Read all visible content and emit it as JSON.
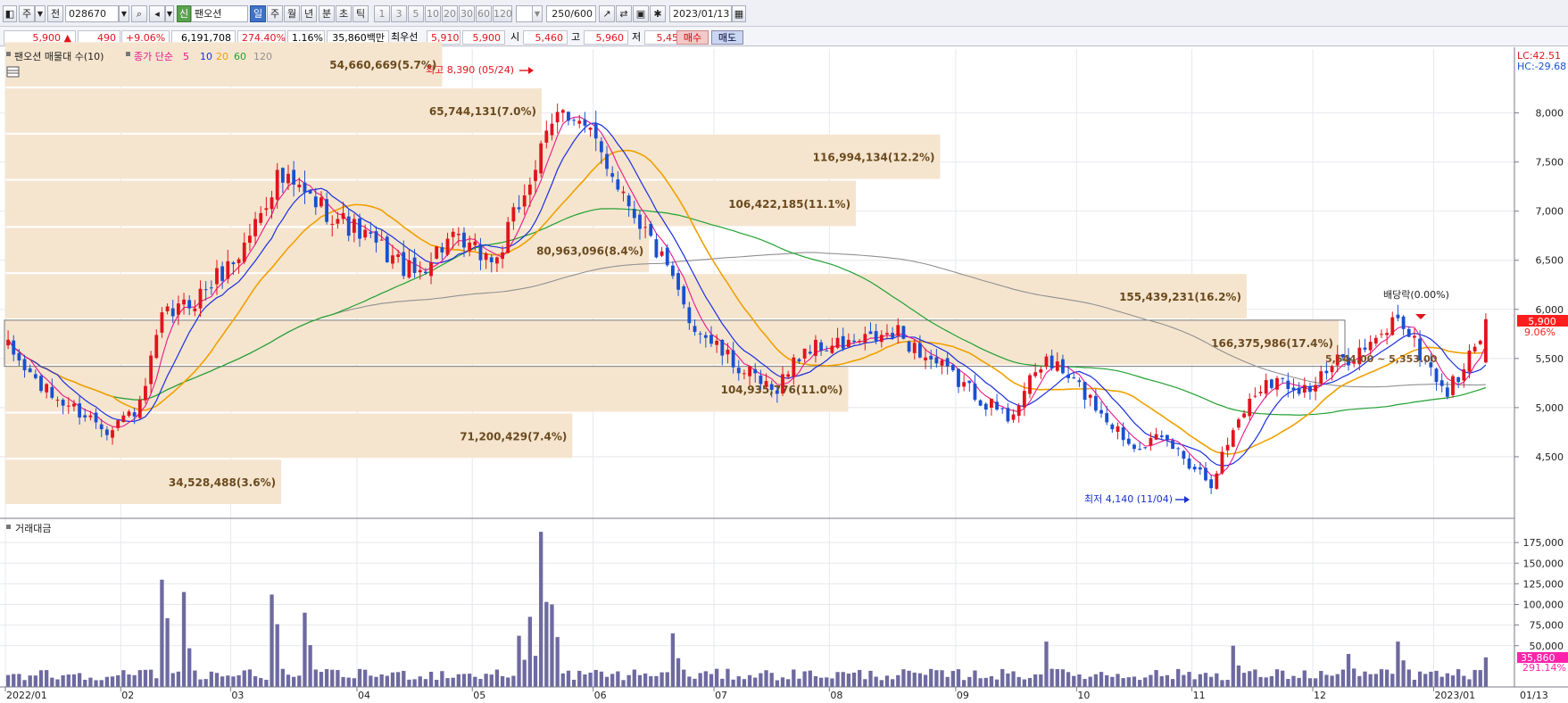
{
  "toolbar": {
    "type_btn": "주",
    "prev_btn": "전",
    "stock_code": "028670",
    "badge": "신",
    "stock_name": "팬오션",
    "periods": [
      "일",
      "주",
      "월",
      "년",
      "분",
      "초",
      "틱"
    ],
    "intervals": [
      "1",
      "3",
      "5",
      "10",
      "20",
      "30",
      "60",
      "120"
    ],
    "count": "250/600",
    "date": "2023/01/13"
  },
  "quote": {
    "price": "5,900",
    "up_arrow": "▲",
    "change": "490",
    "change_pct": "+9.06%",
    "volume": "6,191,708",
    "vol_ratio": "274.40%",
    "turnover": "1.16%",
    "amount": "35,860백만",
    "best_ask_label": "최우선",
    "best_ask_1": "5,910",
    "best_ask_2": "5,900",
    "open_label": "시",
    "open": "5,460",
    "high_label": "고",
    "high": "5,960",
    "low_label": "저",
    "low": "5,450",
    "buy_btn": "매수",
    "sell_btn": "매도"
  },
  "legend": {
    "main": "팬오션 매물대 수(10)",
    "ma_prefix": "종가 단순",
    "ma_periods": [
      "5",
      "10",
      "20",
      "60",
      "120"
    ],
    "volume_panel": "거래대금"
  },
  "colors": {
    "up": "#e0141e",
    "down": "#1a50d0",
    "ma5": "#e8188c",
    "ma10": "#1a2ee0",
    "ma20": "#f0a000",
    "ma60": "#20a030",
    "ma120": "#909090",
    "volume_bar": "#6e6aa0",
    "volume_profile": "#f5e5cf"
  },
  "price_panel": {
    "lc": "LC:42.51",
    "hc": "HC:-29.68",
    "current_price": "5,900",
    "current_pct": "9.06%",
    "high_marker": "최고 8,390 (05/24)",
    "low_marker": "최저 4,140 (11/04)",
    "dividend": "배당락(0.00%)",
    "range_note": "5,544.00 ~ 5,353.00"
  },
  "volume_panel": {
    "current_value": "35,860",
    "current_pct": "291.14%"
  },
  "chart_data": [
    {
      "type": "candlestick",
      "title": "팬오션 매물대 수(10)",
      "x_tick_labels": [
        "2022/01",
        "02",
        "03",
        "04",
        "05",
        "06",
        "07",
        "08",
        "09",
        "10",
        "11",
        "12",
        "2023/01",
        "01/13"
      ],
      "y_ticks": [
        4500,
        5000,
        5500,
        6000,
        6500,
        7000,
        7500,
        8000
      ],
      "y_tick_labels": [
        "4,500",
        "5,000",
        "5,500",
        "6,000",
        "6,500",
        "7,000",
        "7,500",
        "8,000"
      ],
      "ylim": [
        3900,
        8650
      ],
      "price_path": [
        {
          "x": "2022/01/03",
          "y": 5600
        },
        {
          "x": "2022/01/12",
          "y": 5150
        },
        {
          "x": "2022/01/27",
          "y": 4800
        },
        {
          "x": "2022/02/04",
          "y": 5000
        },
        {
          "x": "2022/02/10",
          "y": 5900
        },
        {
          "x": "2022/02/18",
          "y": 6100
        },
        {
          "x": "2022/03/02",
          "y": 6550
        },
        {
          "x": "2022/03/11",
          "y": 7350
        },
        {
          "x": "2022/03/23",
          "y": 7050
        },
        {
          "x": "2022/04/05",
          "y": 6700
        },
        {
          "x": "2022/04/15",
          "y": 6350
        },
        {
          "x": "2022/04/25",
          "y": 6700
        },
        {
          "x": "2022/05/06",
          "y": 6500
        },
        {
          "x": "2022/05/13",
          "y": 7200
        },
        {
          "x": "2022/05/24",
          "y": 8100
        },
        {
          "x": "2022/06/02",
          "y": 7600
        },
        {
          "x": "2022/06/10",
          "y": 7000
        },
        {
          "x": "2022/06/17",
          "y": 6500
        },
        {
          "x": "2022/06/24",
          "y": 5900
        },
        {
          "x": "2022/07/05",
          "y": 5500
        },
        {
          "x": "2022/07/15",
          "y": 5150
        },
        {
          "x": "2022/07/25",
          "y": 5600
        },
        {
          "x": "2022/08/05",
          "y": 5650
        },
        {
          "x": "2022/08/17",
          "y": 5750
        },
        {
          "x": "2022/08/30",
          "y": 5350
        },
        {
          "x": "2022/09/14",
          "y": 4900
        },
        {
          "x": "2022/09/23",
          "y": 5500
        },
        {
          "x": "2022/10/04",
          "y": 5150
        },
        {
          "x": "2022/10/14",
          "y": 4650
        },
        {
          "x": "2022/10/25",
          "y": 4650
        },
        {
          "x": "2022/11/04",
          "y": 4250
        },
        {
          "x": "2022/11/11",
          "y": 4900
        },
        {
          "x": "2022/11/18",
          "y": 5300
        },
        {
          "x": "2022/11/30",
          "y": 5200
        },
        {
          "x": "2022/12/08",
          "y": 5500
        },
        {
          "x": "2022/12/16",
          "y": 5650
        },
        {
          "x": "2022/12/22",
          "y": 5950
        },
        {
          "x": "2022/12/28",
          "y": 5550
        },
        {
          "x": "2023/01/04",
          "y": 5150
        },
        {
          "x": "2023/01/10",
          "y": 5500
        },
        {
          "x": "2023/01/13",
          "y": 5900
        }
      ],
      "volume_profile": [
        {
          "label": "34,528,488(3.6%)",
          "from": 4000,
          "to": 4470,
          "pct": 3.6
        },
        {
          "label": "71,200,429(7.4%)",
          "from": 4470,
          "to": 4940,
          "pct": 7.4
        },
        {
          "label": "104,935,776(11.0%)",
          "from": 4940,
          "to": 5420,
          "pct": 11.0
        },
        {
          "label": "166,375,986(17.4%)",
          "from": 5420,
          "to": 5890,
          "pct": 17.4
        },
        {
          "label": "155,439,231(16.2%)",
          "from": 5890,
          "to": 6360,
          "pct": 16.2
        },
        {
          "label": "80,963,096(8.4%)",
          "from": 6360,
          "to": 6830,
          "pct": 8.4
        },
        {
          "label": "106,422,185(11.1%)",
          "from": 6830,
          "to": 7310,
          "pct": 11.1
        },
        {
          "label": "116,994,134(12.2%)",
          "from": 7310,
          "to": 7780,
          "pct": 12.2
        },
        {
          "label": "65,744,131(7.0%)",
          "from": 7780,
          "to": 8250,
          "pct": 7.0
        },
        {
          "label": "54,660,669(5.7%)",
          "from": 8250,
          "to": 8720,
          "pct": 5.7
        }
      ],
      "moving_averages": [
        "5",
        "10",
        "20",
        "60",
        "120"
      ],
      "markers": [
        {
          "label": "최고 8,390 (05/24)",
          "x": "2022/05/24",
          "y": 8390
        },
        {
          "label": "최저 4,140 (11/04)",
          "x": "2022/11/04",
          "y": 4140
        }
      ]
    },
    {
      "type": "bar",
      "title": "거래대금",
      "y_ticks": [
        50000,
        75000,
        100000,
        125000,
        150000,
        175000
      ],
      "y_tick_labels": [
        "50,000",
        "75,000",
        "100,000",
        "125,000",
        "150,000",
        "175,000"
      ],
      "ylim": [
        0,
        200000
      ],
      "spikes": [
        {
          "x": "2022/02/10",
          "value": 130000
        },
        {
          "x": "2022/02/16",
          "value": 115000
        },
        {
          "x": "2022/03/10",
          "value": 112000
        },
        {
          "x": "2022/03/18",
          "value": 90000
        },
        {
          "x": "2022/05/12",
          "value": 62000
        },
        {
          "x": "2022/05/16",
          "value": 85000
        },
        {
          "x": "2022/05/18",
          "value": 188000
        },
        {
          "x": "2022/05/20",
          "value": 100000
        },
        {
          "x": "2022/06/21",
          "value": 65000
        },
        {
          "x": "2022/09/23",
          "value": 55000
        },
        {
          "x": "2022/11/10",
          "value": 50000
        },
        {
          "x": "2022/12/09",
          "value": 40000
        },
        {
          "x": "2022/12/22",
          "value": 55000
        },
        {
          "x": "2023/01/13",
          "value": 37000
        }
      ],
      "current": 35860
    }
  ]
}
